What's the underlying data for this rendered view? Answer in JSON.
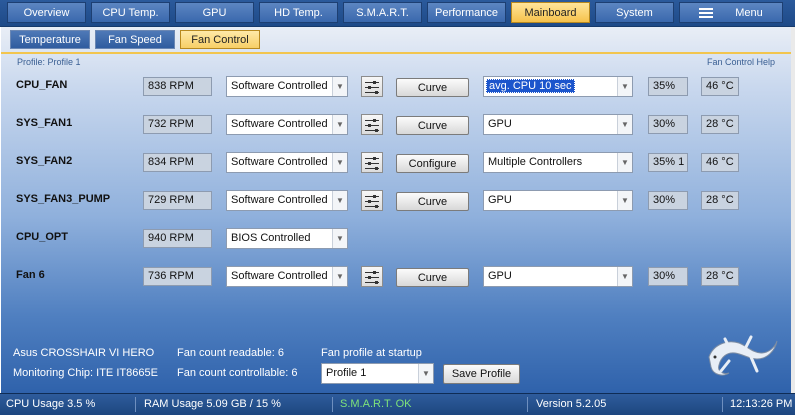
{
  "main_tabs": [
    "Overview",
    "CPU Temp.",
    "GPU",
    "HD Temp.",
    "S.M.A.R.T.",
    "Performance",
    "Mainboard",
    "System",
    "Menu"
  ],
  "active_main_tab": "Mainboard",
  "sub_tabs": [
    "Temperature",
    "Fan Speed",
    "Fan Control"
  ],
  "active_sub_tab": "Fan Control",
  "profile_label": "Profile: Profile 1",
  "help_link": "Fan Control Help",
  "fans": [
    {
      "name": "CPU_FAN",
      "rpm": "838 RPM",
      "mode": "Software Controlled",
      "action": "Curve",
      "source": "avg. CPU 10 sec",
      "percent": "35%",
      "temp": "46 °C"
    },
    {
      "name": "SYS_FAN1",
      "rpm": "732 RPM",
      "mode": "Software Controlled",
      "action": "Curve",
      "source": "GPU",
      "percent": "30%",
      "temp": "28 °C"
    },
    {
      "name": "SYS_FAN2",
      "rpm": "834 RPM",
      "mode": "Software Controlled",
      "action": "Configure",
      "source": "Multiple Controllers",
      "percent": "35% 1",
      "temp": "46 °C"
    },
    {
      "name": "SYS_FAN3_PUMP",
      "rpm": "729 RPM",
      "mode": "Software Controlled",
      "action": "Curve",
      "source": "GPU",
      "percent": "30%",
      "temp": "28 °C"
    },
    {
      "name": "CPU_OPT",
      "rpm": "940 RPM",
      "mode": "BIOS Controlled"
    },
    {
      "name": "Fan 6",
      "rpm": "736 RPM",
      "mode": "Software Controlled",
      "action": "Curve",
      "source": "GPU",
      "percent": "30%",
      "temp": "28 °C"
    }
  ],
  "footer": {
    "board": "Asus CROSSHAIR VI HERO",
    "chip": "Monitoring Chip: ITE IT8665E",
    "fan_readable": "Fan count readable: 6",
    "fan_controllable": "Fan count controllable: 6",
    "startup_label": "Fan profile at startup",
    "startup_profile": "Profile 1",
    "save_button": "Save Profile"
  },
  "status": {
    "cpu": "CPU Usage 3.5 %",
    "ram": "RAM Usage 5.09 GB / 15 %",
    "smart": "S.M.A.R.T. OK",
    "version": "Version 5.2.05",
    "time": "12:13:26 PM"
  },
  "colors": {
    "active_tab": "#f6c24c",
    "smart_ok": "#7ee27a",
    "selection": "#1c55cc"
  }
}
